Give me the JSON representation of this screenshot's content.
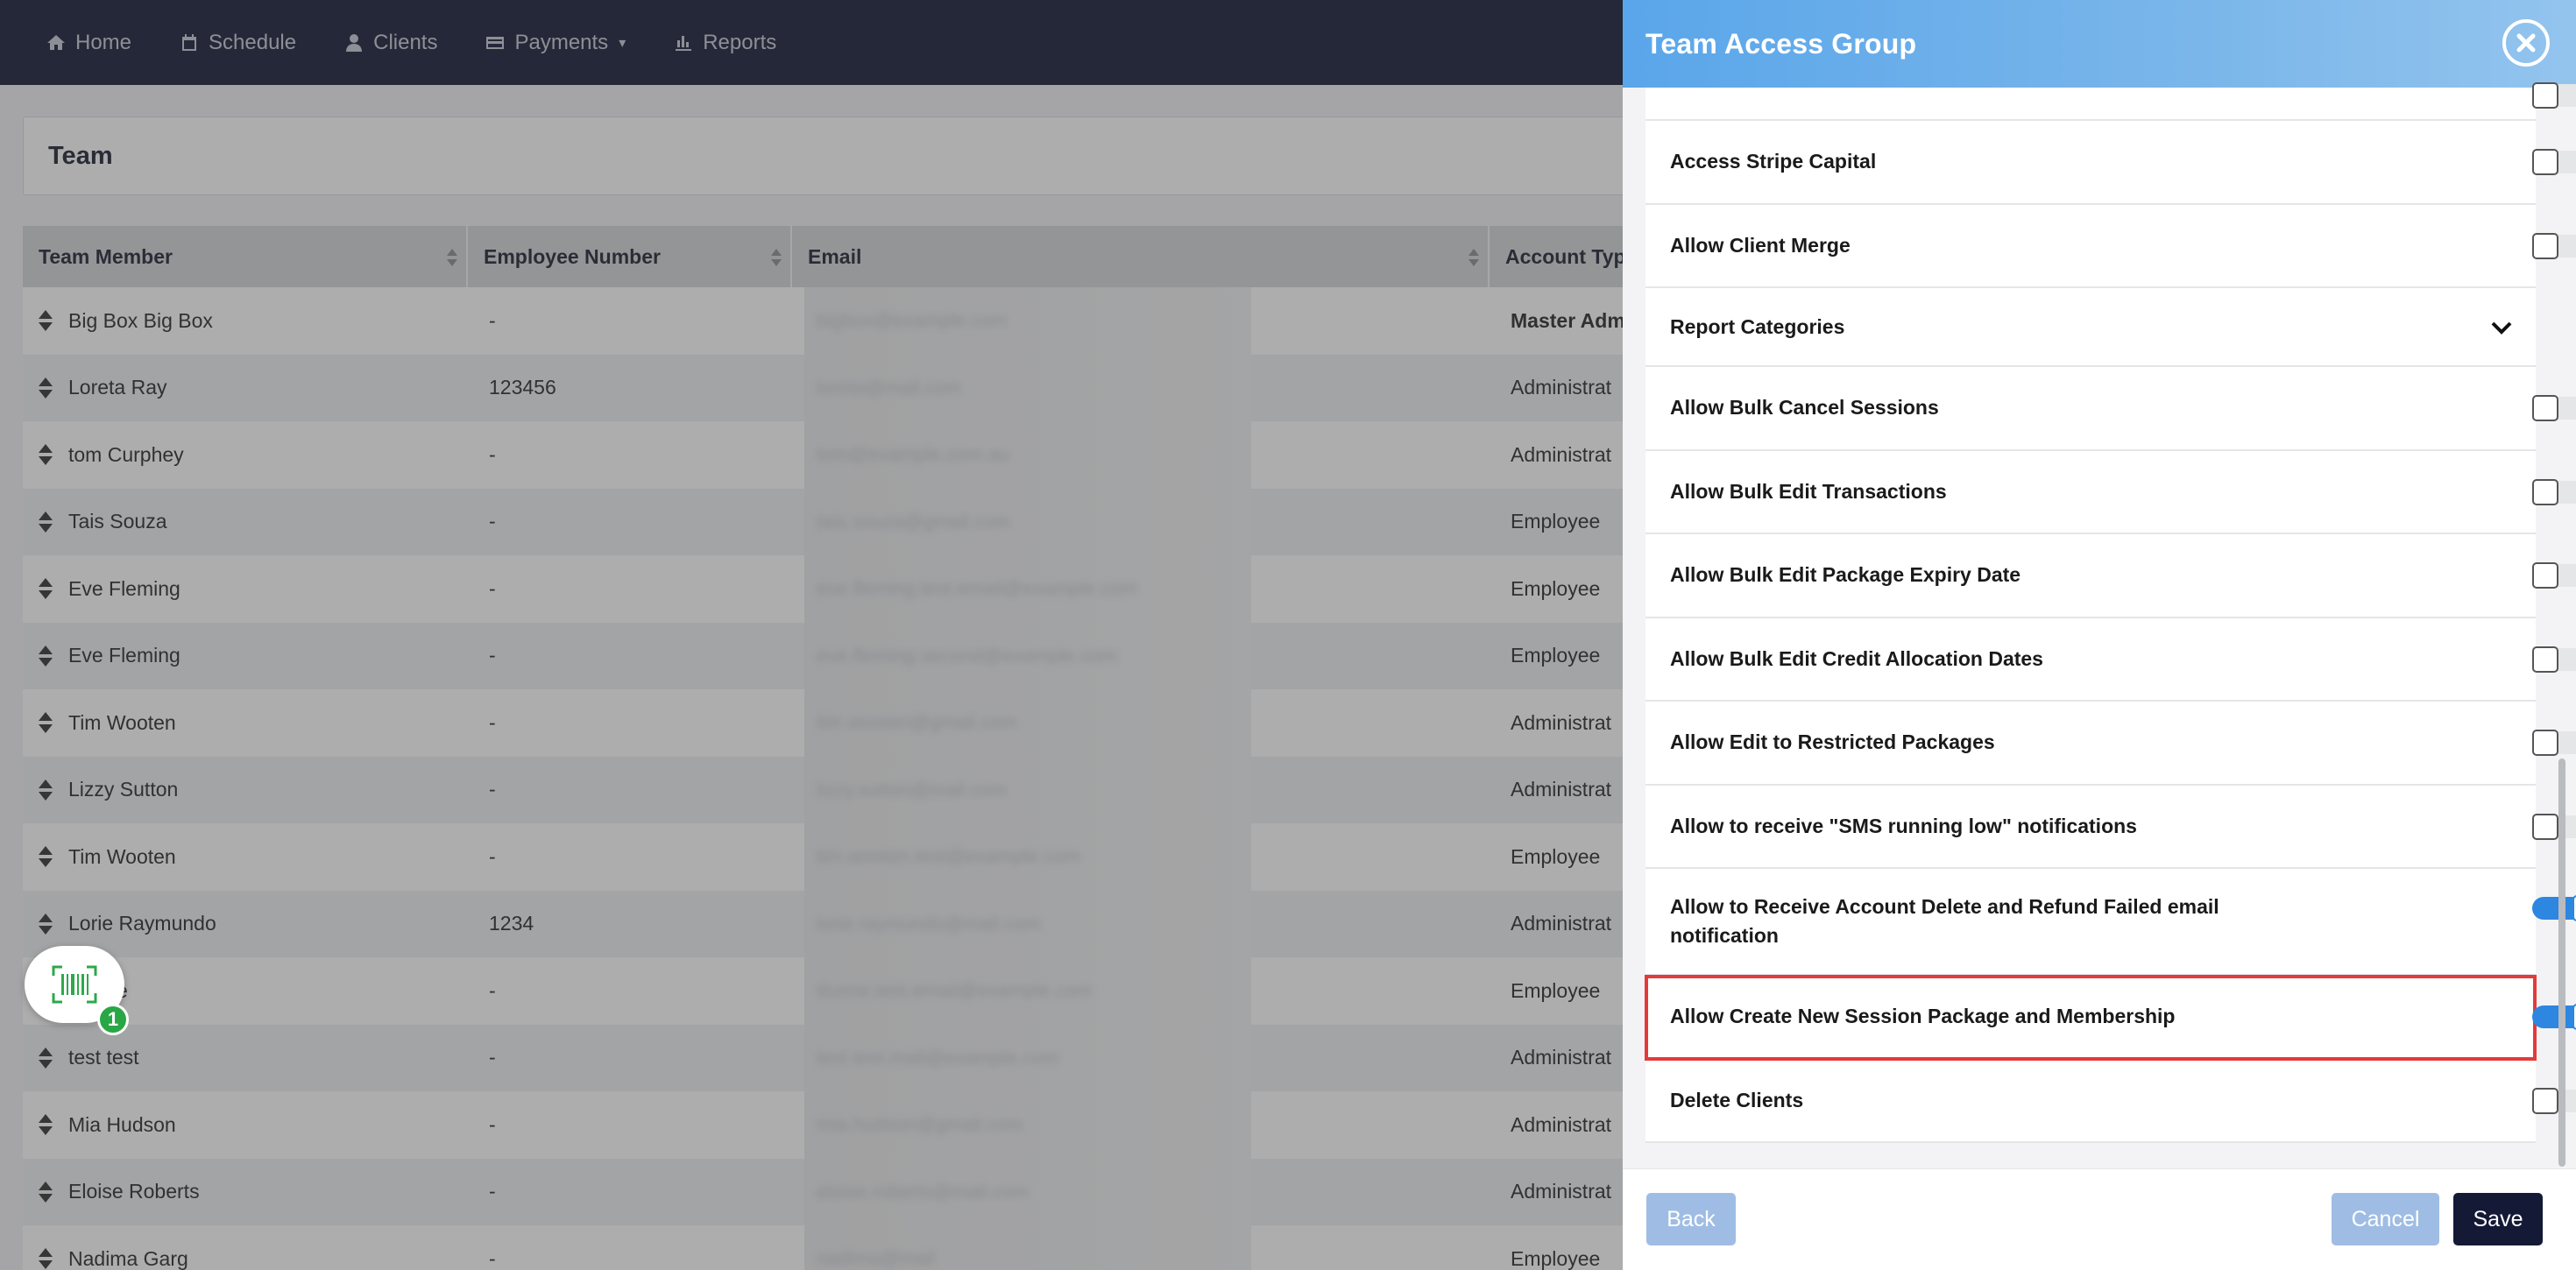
{
  "nav": {
    "items": [
      {
        "label": "Home",
        "icon": "home-icon"
      },
      {
        "label": "Schedule",
        "icon": "calendar-icon"
      },
      {
        "label": "Clients",
        "icon": "user-icon"
      },
      {
        "label": "Payments",
        "icon": "credit-card-icon"
      },
      {
        "label": "Reports",
        "icon": "bar-chart-icon"
      }
    ]
  },
  "team": {
    "title": "Team",
    "columns": [
      "Team Member",
      "Employee Number",
      "Email",
      "Account Typ"
    ],
    "rows": [
      {
        "name": "Big Box Big Box",
        "number": "-",
        "email": "bigbox@example.com",
        "type": "Master Adm"
      },
      {
        "name": "Loreta Ray",
        "number": "123456",
        "email": "loreta@mail.com",
        "type": "Administrat"
      },
      {
        "name": "tom Curphey",
        "number": "-",
        "email": "tom@example.com.au",
        "type": "Administrat"
      },
      {
        "name": "Tais Souza",
        "number": "-",
        "email": "tais.souza@gmail.com",
        "type": "Employee"
      },
      {
        "name": "Eve Fleming",
        "number": "-",
        "email": "eve.fleming.test.email@example.com",
        "type": "Employee"
      },
      {
        "name": "Eve Fleming",
        "number": "-",
        "email": "eve.fleming.second@example.com",
        "type": "Employee"
      },
      {
        "name": "Tim Wooten",
        "number": "-",
        "email": "tim.wooten@gmail.com",
        "type": "Administrat"
      },
      {
        "name": "Lizzy Sutton",
        "number": "-",
        "email": "lizzy.sutton@mail.com",
        "type": "Administrat"
      },
      {
        "name": "Tim Wooten",
        "number": "-",
        "email": "tim.wooten.test@example.com",
        "type": "Employee"
      },
      {
        "name": "Lorie Raymundo",
        "number": "1234",
        "email": "lorie.raymundo@mail.com",
        "type": "Administrat"
      },
      {
        "name": "Dunne",
        "number": "-",
        "email": "dunne.test.email@example.com",
        "type": "Employee"
      },
      {
        "name": "test test",
        "number": "-",
        "email": "test.test.mail@example.com",
        "type": "Administrat"
      },
      {
        "name": "Mia Hudson",
        "number": "-",
        "email": "mia.hudson@gmail.com",
        "type": "Administrat"
      },
      {
        "name": "Eloise Roberts",
        "number": "-",
        "email": "eloise.roberts@mail.com",
        "type": "Administrat"
      },
      {
        "name": "Nadima Garg",
        "number": "-",
        "email": "nadima@mail",
        "type": "Employee"
      }
    ]
  },
  "widget": {
    "badge": "1",
    "icon": "barcode-scanner-icon"
  },
  "panel": {
    "title": "Team Access Group",
    "permissions": [
      {
        "label": "Access Stripe Capital",
        "on": false
      },
      {
        "label": "Allow Client Merge",
        "on": false
      },
      {
        "label": "Report Categories",
        "category": true
      },
      {
        "label": "Allow Bulk Cancel Sessions",
        "on": false
      },
      {
        "label": "Allow Bulk Edit Transactions",
        "on": false
      },
      {
        "label": "Allow Bulk Edit Package Expiry Date",
        "on": false
      },
      {
        "label": "Allow Bulk Edit Credit Allocation Dates",
        "on": false
      },
      {
        "label": "Allow Edit to Restricted Packages",
        "on": false
      },
      {
        "label": "Allow to receive \"SMS running low\" notifications",
        "on": false
      },
      {
        "label": "Allow to Receive Account Delete and Refund Failed email notification",
        "on": true
      },
      {
        "label": "Allow Create New Session Package and Membership",
        "on": true,
        "highlighted": true
      },
      {
        "label": "Delete Clients",
        "on": false
      }
    ],
    "buttons": {
      "back": "Back",
      "cancel": "Cancel",
      "save": "Save"
    }
  },
  "colors": {
    "nav_bg": "#161a36",
    "panel_header": "#5aa6ea",
    "toggle_on": "#2d86e0",
    "highlight": "#e33a3a",
    "save_bg": "#141935",
    "badge": "#29a745"
  }
}
